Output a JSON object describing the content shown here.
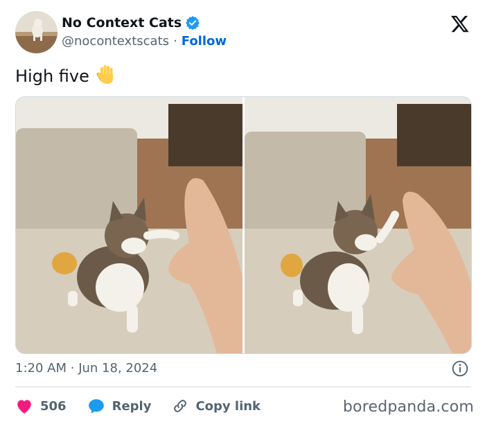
{
  "author": {
    "display_name": "No Context Cats",
    "handle": "@nocontextscats",
    "separator": "·",
    "follow_label": "Follow"
  },
  "tweet": {
    "text": "High five",
    "emoji": "🖐️"
  },
  "meta": {
    "time": "1:20 AM",
    "separator": "·",
    "date": "Jun 18, 2024"
  },
  "actions": {
    "like_count": "506",
    "reply_label": "Reply",
    "copy_link_label": "Copy link"
  },
  "watermark": "boredpanda.com",
  "colors": {
    "accent": "#1d9bf0",
    "follow": "#0068d6",
    "like": "#f91880",
    "secondary_text": "#536471"
  },
  "icons": [
    "verified-badge-icon",
    "x-logo-icon",
    "info-icon",
    "heart-icon",
    "reply-bubble-icon",
    "link-icon"
  ]
}
